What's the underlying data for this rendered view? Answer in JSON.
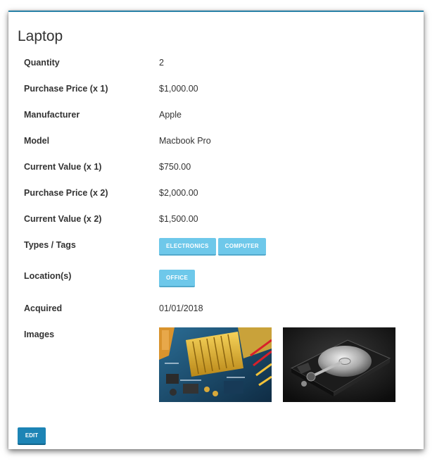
{
  "item": {
    "title": "Laptop"
  },
  "details": [
    {
      "label": "Quantity",
      "value": "2"
    },
    {
      "label": "Purchase Price (x 1)",
      "value": "$1,000.00"
    },
    {
      "label": "Manufacturer",
      "value": "Apple"
    },
    {
      "label": "Model",
      "value": "Macbook Pro"
    },
    {
      "label": "Current Value (x 1)",
      "value": "$750.00"
    },
    {
      "label": "Purchase Price (x 2)",
      "value": "$2,000.00"
    },
    {
      "label": "Current Value (x 2)",
      "value": "$1,500.00"
    }
  ],
  "types_tags": {
    "label": "Types / Tags",
    "tags": [
      "ELECTRONICS",
      "COMPUTER"
    ]
  },
  "locations": {
    "label": "Location(s)",
    "tags": [
      "OFFICE"
    ]
  },
  "acquired": {
    "label": "Acquired",
    "value": "01/01/2018"
  },
  "images": {
    "label": "Images",
    "items": [
      {
        "name": "motherboard-image",
        "subject": "circuit board with heatsink"
      },
      {
        "name": "hard-drive-image",
        "subject": "open hard disk drive"
      }
    ]
  },
  "actions": {
    "edit_label": "EDIT"
  },
  "colors": {
    "accent": "#2a83a8",
    "tag_bg": "#6ec8ea",
    "button_bg": "#1d84b5",
    "text": "#333333"
  }
}
